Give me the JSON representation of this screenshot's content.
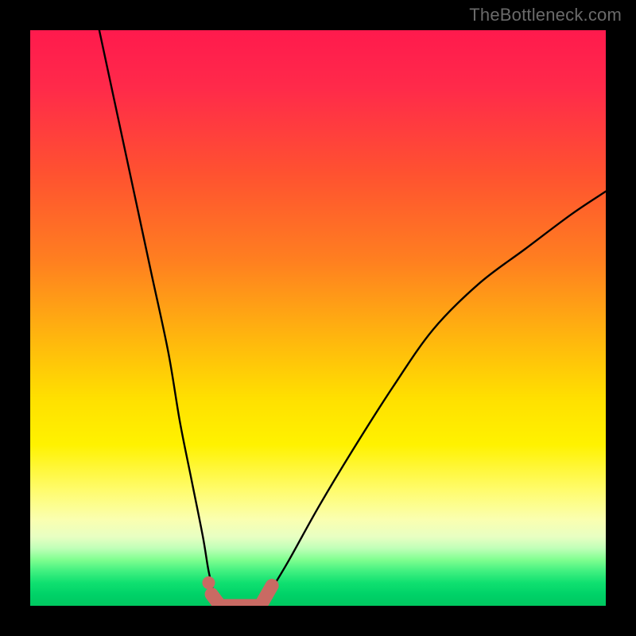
{
  "watermark": "TheBottleneck.com",
  "colors": {
    "curve_stroke": "#000000",
    "marker_stroke": "#c96a63",
    "marker_fill": "#c96a63",
    "background_black": "#000000"
  },
  "chart_data": {
    "type": "line",
    "title": "",
    "xlabel": "",
    "ylabel": "",
    "xlim": [
      0,
      100
    ],
    "ylim": [
      0,
      100
    ],
    "grid": false,
    "series": [
      {
        "name": "left-branch",
        "x": [
          12,
          15,
          18,
          21,
          24,
          26,
          28,
          30,
          31,
          32,
          33
        ],
        "y": [
          100,
          86,
          72,
          58,
          44,
          32,
          22,
          12,
          6,
          2,
          0
        ]
      },
      {
        "name": "right-branch",
        "x": [
          40,
          42,
          45,
          50,
          56,
          63,
          70,
          78,
          86,
          94,
          100
        ],
        "y": [
          0,
          3,
          8,
          17,
          27,
          38,
          48,
          56,
          62,
          68,
          72
        ]
      }
    ],
    "markers": [
      {
        "shape": "dot",
        "x": 31.0,
        "y": 4.0
      },
      {
        "shape": "segment",
        "x0": 31.5,
        "y0": 2.0,
        "x1": 33.0,
        "y1": 0.0
      },
      {
        "shape": "segment",
        "x0": 33.0,
        "y0": 0.0,
        "x1": 40.0,
        "y1": 0.0
      },
      {
        "shape": "segment",
        "x0": 40.0,
        "y0": 0.0,
        "x1": 42.0,
        "y1": 3.5
      }
    ]
  }
}
